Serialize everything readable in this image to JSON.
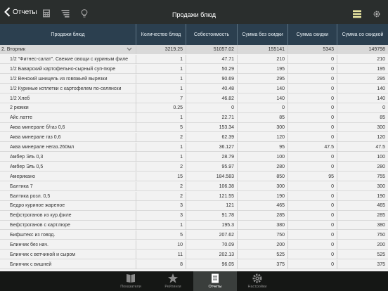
{
  "nav": {
    "back_label": "Отчеты",
    "title": "Продажи блюд"
  },
  "table": {
    "columns": [
      "Продажи блюд",
      "Количество блюд",
      "Себестоимость",
      "Сумма без скидки",
      "Сумма скидки",
      "Сумма со скидкой"
    ],
    "group": {
      "name": "2. Вторник",
      "qty": "3219.25",
      "cost": "51057.02",
      "gross": "155141",
      "discount": "5343",
      "net": "149798"
    },
    "rows": [
      {
        "name": "1/2 \"Фитнес-салат\". Свежие овощи с куриным филе",
        "qty": "1",
        "cost": "47.71",
        "gross": "210",
        "discount": "0",
        "net": "210"
      },
      {
        "name": "1/2 Баварский картофельно-сырный суп-пюре",
        "qty": "1",
        "cost": "50.29",
        "gross": "195",
        "discount": "0",
        "net": "195"
      },
      {
        "name": "1/2 Венский шницель из говяжьей вырезки",
        "qty": "1",
        "cost": "90.69",
        "gross": "295",
        "discount": "0",
        "net": "295"
      },
      {
        "name": "1/2 Куриные котлетки с картофелем по-селянски",
        "qty": "1",
        "cost": "40.48",
        "gross": "140",
        "discount": "0",
        "net": "140"
      },
      {
        "name": "1/2 Хлеб",
        "qty": "7",
        "cost": "46.82",
        "gross": "140",
        "discount": "0",
        "net": "140"
      },
      {
        "name": "2 рюмки",
        "qty": "0.25",
        "cost": "0",
        "gross": "0",
        "discount": "0",
        "net": "0"
      },
      {
        "name": "Айс латте",
        "qty": "1",
        "cost": "22.71",
        "gross": "85",
        "discount": "0",
        "net": "85"
      },
      {
        "name": "Аква минерале б/газ 0,6",
        "qty": "5",
        "cost": "153.34",
        "gross": "300",
        "discount": "0",
        "net": "300"
      },
      {
        "name": "Аква минерале газ 0,6",
        "qty": "2",
        "cost": "62.39",
        "gross": "120",
        "discount": "0",
        "net": "120"
      },
      {
        "name": "Аква минерале негаз.260мл",
        "qty": "1",
        "cost": "36.127",
        "gross": "95",
        "discount": "47.5",
        "net": "47.5"
      },
      {
        "name": "Амбер Эль 0,3",
        "qty": "1",
        "cost": "28.79",
        "gross": "100",
        "discount": "0",
        "net": "100"
      },
      {
        "name": "Амбер Эль 0,5",
        "qty": "2",
        "cost": "95.97",
        "gross": "280",
        "discount": "0",
        "net": "280"
      },
      {
        "name": "Американо",
        "qty": "15",
        "cost": "184.583",
        "gross": "850",
        "discount": "95",
        "net": "755"
      },
      {
        "name": "Балтика 7",
        "qty": "2",
        "cost": "106.38",
        "gross": "300",
        "discount": "0",
        "net": "300"
      },
      {
        "name": "Балтика розл. 0,5",
        "qty": "2",
        "cost": "121.55",
        "gross": "190",
        "discount": "0",
        "net": "190"
      },
      {
        "name": "Бедро куриное жареное",
        "qty": "3",
        "cost": "121",
        "gross": "465",
        "discount": "0",
        "net": "465"
      },
      {
        "name": "Бефстроганов из кур.филе",
        "qty": "3",
        "cost": "91.78",
        "gross": "285",
        "discount": "0",
        "net": "285"
      },
      {
        "name": "Бефстроганов с карт.пюре",
        "qty": "1",
        "cost": "195.3",
        "gross": "380",
        "discount": "0",
        "net": "380"
      },
      {
        "name": "Бифштекс из говяд.",
        "qty": "5",
        "cost": "207.62",
        "gross": "750",
        "discount": "0",
        "net": "750"
      },
      {
        "name": "Блинчик без нач.",
        "qty": "10",
        "cost": "70.09",
        "gross": "200",
        "discount": "0",
        "net": "200"
      },
      {
        "name": "Блинчик с ветчиной и сыром",
        "qty": "11",
        "cost": "202.13",
        "gross": "525",
        "discount": "0",
        "net": "525"
      },
      {
        "name": "Блинчик с вишней",
        "qty": "8",
        "cost": "96.05",
        "gross": "375",
        "discount": "0",
        "net": "375"
      }
    ]
  },
  "tabs": [
    {
      "label": "Показатели",
      "icon": "book-icon"
    },
    {
      "label": "Рейтинги",
      "icon": "star-icon"
    },
    {
      "label": "Отчеты",
      "icon": "document-icon"
    },
    {
      "label": "Настройки",
      "icon": "gear-icon"
    }
  ],
  "colors": {
    "topbar": "#2a2e2d",
    "header": "#2b3f4f",
    "group_row": "#d9d9d9",
    "tabbar": "#151715"
  }
}
